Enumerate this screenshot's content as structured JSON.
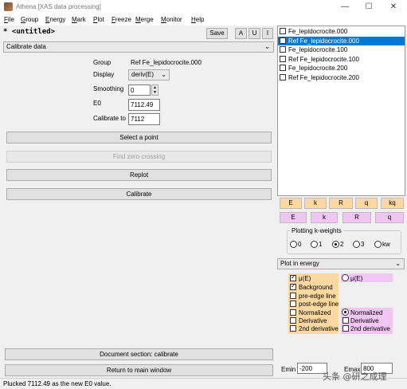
{
  "window": {
    "title": "Athena [XAS data processing]",
    "controls": [
      "—",
      "☐",
      "✕"
    ]
  },
  "menu": [
    "File",
    "Group",
    "Energy",
    "Mark",
    "Plot",
    "Freeze",
    "Merge",
    "Monitor",
    "Help"
  ],
  "project": {
    "name": "* <untitled>",
    "save_label": "Save",
    "buttons": [
      "A",
      "U",
      "I"
    ]
  },
  "main_select": "Calibrate data",
  "calibrate": {
    "group_label": "Group",
    "group_value": "Ref Fe_lepidocrocite.000",
    "display_label": "Display",
    "display_value": "deriv(E)",
    "smoothing_label": "Smoothing",
    "smoothing_value": "0",
    "e0_label": "E0",
    "e0_value": "7112.49",
    "calibrate_to_label": "Calibrate to",
    "calibrate_to_value": "7112",
    "select_point": "Select a point",
    "find_zero": "Find zero crossing",
    "replot": "Replot",
    "calibrate": "Calibrate"
  },
  "bottom": {
    "doc_section": "Document section: calibrate",
    "return_main": "Return to main window"
  },
  "status": "Plucked  7112.49 as the new E0 value.",
  "group_list": [
    {
      "name": "Fe_lepidocrocite.000",
      "checked": false,
      "selected": false
    },
    {
      "name": "Ref Fe_lepidocrocite.000",
      "checked": false,
      "selected": true
    },
    {
      "name": "Fe_lepidocrocite.100",
      "checked": false,
      "selected": false
    },
    {
      "name": "Ref Fe_lepidocrocite.100",
      "checked": false,
      "selected": false
    },
    {
      "name": "Fe_lepidocrocite.200",
      "checked": false,
      "selected": false
    },
    {
      "name": "Ref Fe_lepidocrocite.200",
      "checked": false,
      "selected": false
    }
  ],
  "plot_buttons_row1": [
    "E",
    "k",
    "R",
    "q",
    "kq"
  ],
  "plot_buttons_row2": [
    "E",
    "k",
    "R",
    "q"
  ],
  "kweights": {
    "title": "Plotting k-weights",
    "options": [
      "0",
      "1",
      "2",
      "3",
      "kw"
    ],
    "selected": "2"
  },
  "plot_in": "Plot in energy",
  "energy_options": {
    "mu": "μ(E)",
    "mu_right": "μ(E)",
    "background": "Background",
    "pre_edge": "pre-edge line",
    "post_edge": "post-edge line",
    "normalized": "Normalized",
    "normalized_right": "Normalized",
    "derivative": "Derivative",
    "derivative_right": "Derivative",
    "second_deriv": "2nd derivative",
    "second_deriv_right": "2nd derivative"
  },
  "emin_label": "Emin",
  "emin_value": "-200",
  "emax_label": "Emax",
  "emax_value": "800",
  "watermark": "头条 @研之成理"
}
